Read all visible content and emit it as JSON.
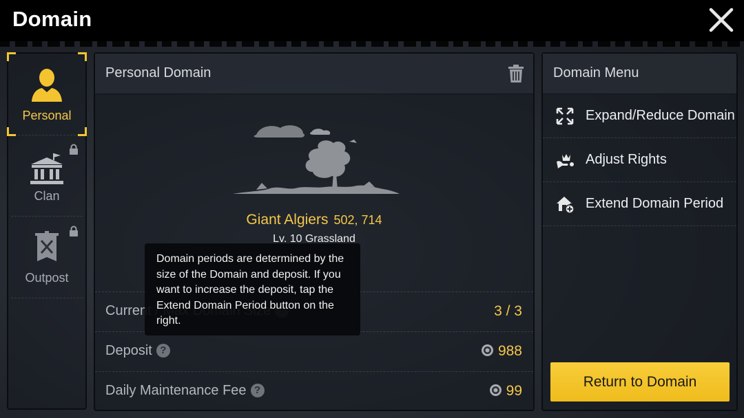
{
  "window": {
    "title": "Domain"
  },
  "sidebar": {
    "items": [
      {
        "label": "Personal",
        "icon": "person-icon",
        "active": true,
        "locked": false
      },
      {
        "label": "Clan",
        "icon": "clan-hall-icon",
        "active": false,
        "locked": true
      },
      {
        "label": "Outpost",
        "icon": "outpost-banner-icon",
        "active": false,
        "locked": true
      }
    ]
  },
  "personal_domain": {
    "title": "Personal Domain",
    "name": "Giant Algiers",
    "coords": "502, 714",
    "level_type": "Lv. 10 Grassland",
    "rows": [
      {
        "label": "Current / Max Domain Size",
        "value": "3 / 3"
      },
      {
        "label": "Deposit",
        "value": "988"
      },
      {
        "label": "Daily Maintenance Fee",
        "value": "99"
      }
    ],
    "tooltip": "Domain periods are determined by the size of the Domain and deposit. If you want to increase the deposit, tap the Extend Domain Period button on the right."
  },
  "domain_menu": {
    "title": "Domain Menu",
    "items": [
      {
        "label": "Expand/Reduce Domain",
        "icon": "expand-arrows-icon"
      },
      {
        "label": "Adjust Rights",
        "icon": "crown-hand-icon"
      },
      {
        "label": "Extend Domain Period",
        "icon": "house-plus-icon"
      }
    ],
    "return_button": "Return to Domain"
  },
  "colors": {
    "accent": "#f4c84a",
    "button": "#f5c530",
    "panel": "#1b1f25"
  }
}
